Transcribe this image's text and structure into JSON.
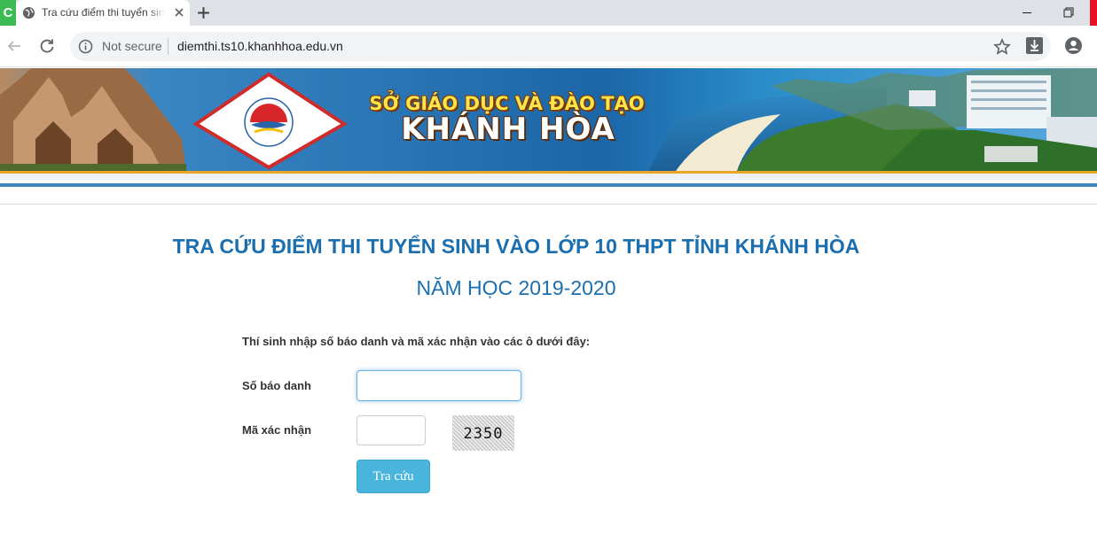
{
  "browser": {
    "app_chip_label": "C",
    "tab_title": "Tra cứu điểm thi tuyển sinh",
    "security_label": "Not secure",
    "url": "diemthi.ts10.khanhhoa.edu.vn",
    "icons": [
      "globe-icon",
      "close-icon",
      "plus-icon",
      "minimize-icon",
      "restore-icon",
      "back-icon",
      "reload-icon",
      "info-icon",
      "star-icon",
      "download-icon",
      "profile-icon"
    ]
  },
  "banner": {
    "logo_ring_text": "GIÁO DỤC ĐÀO TẠO KHÁNH HÒA",
    "dept_line1": "SỞ GIÁO DỤC VÀ ĐÀO TẠO",
    "dept_line2": "KHÁNH HÒA"
  },
  "page": {
    "title": "TRA CỨU ĐIỂM THI TUYỂN SINH VÀO LỚP 10 THPT TỈNH KHÁNH HÒA",
    "subtitle": "NĂM HỌC 2019-2020",
    "instruction": "Thí sinh nhập số báo danh và mã xác nhận vào các ô dưới đây:",
    "candidate_label": "Số báo danh",
    "candidate_value": "",
    "captcha_label": "Mã xác nhận",
    "captcha_value": "",
    "captcha_code": "2350",
    "submit_label": "Tra cứu"
  },
  "colors": {
    "title_blue": "#1b6fae",
    "button_blue": "#4ab5dc",
    "banner_stripe": "#3c87bf"
  }
}
